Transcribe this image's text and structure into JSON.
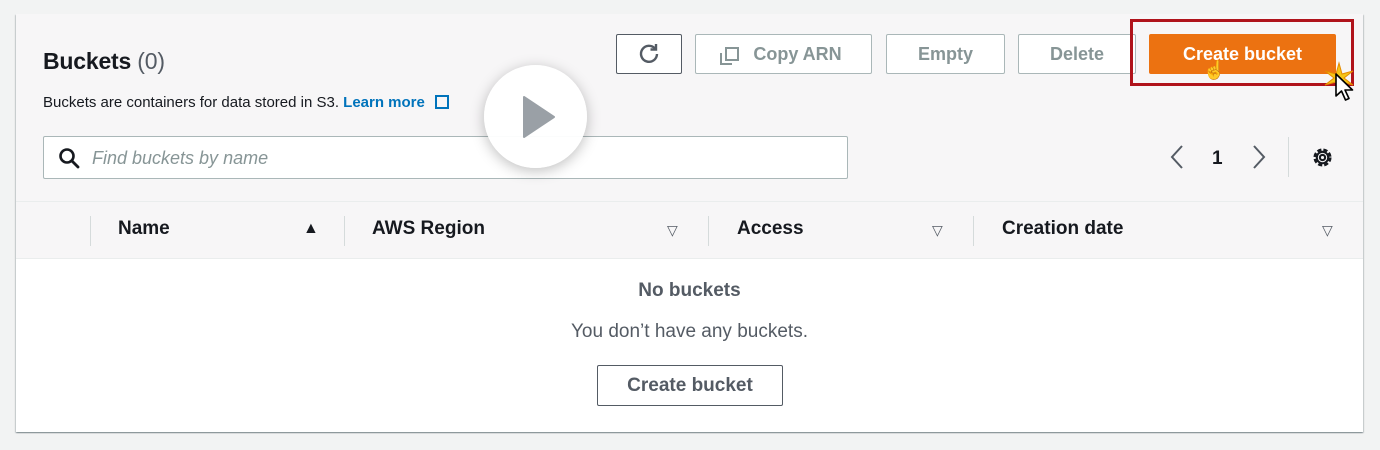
{
  "header": {
    "title": "Buckets",
    "count": "(0)",
    "description": "Buckets are containers for data stored in S3.",
    "learn_more": "Learn more"
  },
  "toolbar": {
    "refresh_icon": "refresh-icon",
    "copy_arn_label": "Copy ARN",
    "empty_label": "Empty",
    "delete_label": "Delete",
    "create_label": "Create bucket"
  },
  "search": {
    "placeholder": "Find buckets by name",
    "value": ""
  },
  "pagination": {
    "current_page": "1"
  },
  "table": {
    "columns": [
      {
        "label": "Name",
        "sort": "ascending"
      },
      {
        "label": "AWS Region",
        "sort": "none"
      },
      {
        "label": "Access",
        "sort": "none"
      },
      {
        "label": "Creation date",
        "sort": "none"
      }
    ],
    "rows": []
  },
  "empty_state": {
    "title": "No buckets",
    "description": "You don’t have any buckets.",
    "button_label": "Create bucket"
  },
  "colors": {
    "primary": "#ec7211",
    "link": "#0073bb",
    "highlight": "#b0131b"
  },
  "overlay": {
    "play_icon": "play-icon",
    "cursor": "hand-pointer-icon"
  }
}
